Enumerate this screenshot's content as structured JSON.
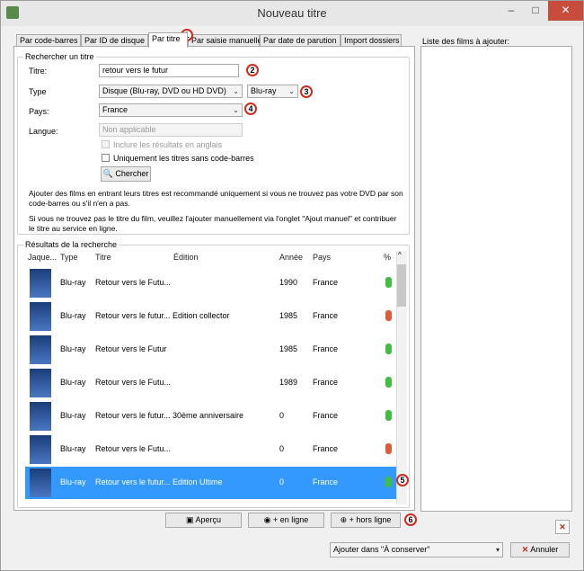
{
  "window": {
    "title": "Nouveau titre",
    "min": "–",
    "max": "□",
    "close": "✕"
  },
  "tabs": [
    {
      "label": "Par code-barres"
    },
    {
      "label": "Par ID de disque"
    },
    {
      "label": "Par titre"
    },
    {
      "label": "Par saisie manuelle"
    },
    {
      "label": "Par date de parution"
    },
    {
      "label": "Import dossiers"
    }
  ],
  "search": {
    "legend": "Rechercher un titre",
    "title_label": "Titre:",
    "title_value": "retour vers le futur",
    "type_label": "Type",
    "type_value": "Disque (Blu-ray, DVD ou HD DVD)",
    "format_value": "Blu-ray",
    "country_label": "Pays:",
    "country_value": "France",
    "language_label": "Langue:",
    "language_value": "Non applicable",
    "include_english_label": "Inclure les résultats en anglais",
    "no_barcode_label": "Uniquement les titres sans code-barres",
    "search_button": "Chercher",
    "help_text_1": "Ajouter des films en entrant leurs titres est recommandé uniquement si vous ne trouvez pas votre DVD par son code-barres ou s'il n'en a pas.",
    "help_text_2": "Si vous ne trouvez pas le titre du film, veuillez l'ajouter manuellement via l'onglet \"Ajout manuel\" et contribuer le titre au service en ligne."
  },
  "results": {
    "legend": "Résultats de la recherche",
    "columns": [
      "Jaque...",
      "Type",
      "Titre",
      "Édition",
      "Année",
      "Pays",
      "%"
    ],
    "rows": [
      {
        "type": "Blu-ray",
        "title": "Retour vers le Futu...",
        "edition": "",
        "year": "1990",
        "country": "France",
        "pct_color": "#3fbf3f"
      },
      {
        "type": "Blu-ray",
        "title": "Retour vers le futur...",
        "edition": "Edition collector",
        "year": "1985",
        "country": "France",
        "pct_color": "#e05a3a"
      },
      {
        "type": "Blu-ray",
        "title": "Retour vers le Futur",
        "edition": "",
        "year": "1985",
        "country": "France",
        "pct_color": "#3fbf3f"
      },
      {
        "type": "Blu-ray",
        "title": "Retour vers le Futu...",
        "edition": "",
        "year": "1989",
        "country": "France",
        "pct_color": "#3fbf3f"
      },
      {
        "type": "Blu-ray",
        "title": "Retour vers le futur...",
        "edition": "30ème anniversaire",
        "year": "0",
        "country": "France",
        "pct_color": "#3fbf3f"
      },
      {
        "type": "Blu-ray",
        "title": "Retour vers le Futu...",
        "edition": "",
        "year": "0",
        "country": "France",
        "pct_color": "#e05a3a"
      },
      {
        "type": "Blu-ray",
        "title": "Retour vers le futur...",
        "edition": "Edition Ultime",
        "year": "0",
        "country": "France",
        "pct_color": "#3fbf3f"
      }
    ]
  },
  "actions": {
    "preview": "Aperçu",
    "online": "+ en ligne",
    "offline": "+ hors ligne"
  },
  "list": {
    "title": "Liste des films à ajouter:"
  },
  "footer": {
    "add_to": "Ajouter dans \"À conserver\"",
    "cancel": "Annuler"
  },
  "callouts": [
    "1",
    "2",
    "3",
    "4",
    "5",
    "6"
  ]
}
